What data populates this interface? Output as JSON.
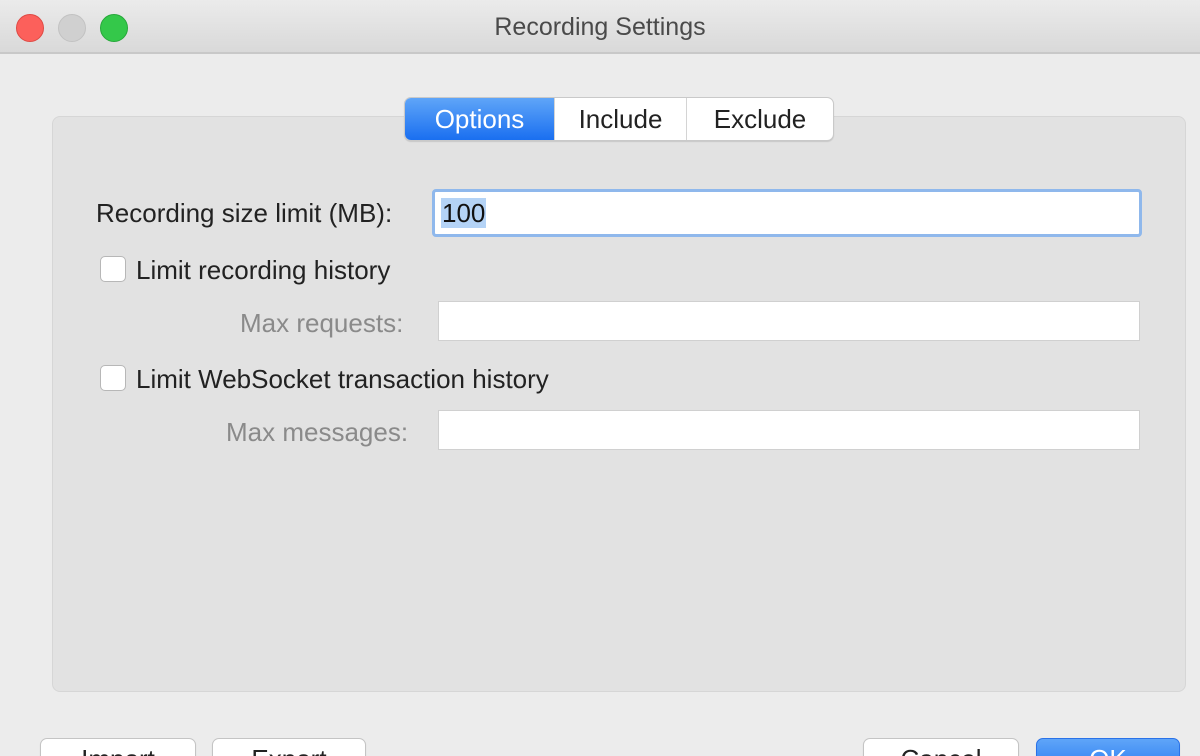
{
  "window": {
    "title": "Recording Settings",
    "traffic_lights": [
      "close",
      "minimize",
      "zoom"
    ]
  },
  "tabs": [
    {
      "label": "Options",
      "selected": true
    },
    {
      "label": "Include",
      "selected": false
    },
    {
      "label": "Exclude",
      "selected": false
    }
  ],
  "form": {
    "size_limit": {
      "label": "Recording size limit (MB):",
      "value": "100"
    },
    "limit_history": {
      "label": "Limit recording history",
      "checked": false
    },
    "max_requests": {
      "label": "Max requests:",
      "value": ""
    },
    "limit_websocket": {
      "label": "Limit WebSocket transaction history",
      "checked": false
    },
    "max_messages": {
      "label": "Max messages:",
      "value": ""
    }
  },
  "buttons": {
    "import": "Import",
    "export": "Export",
    "cancel": "Cancel",
    "ok": "OK"
  },
  "colors": {
    "accent": "#1a6ff0",
    "close": "#fc605b",
    "zoom": "#34c84a"
  }
}
